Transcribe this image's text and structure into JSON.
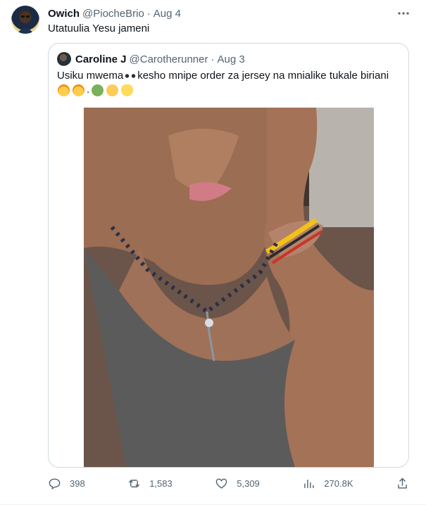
{
  "tweet": {
    "author_name": "Owich",
    "author_handle": "@PiocheBrio",
    "separator": "·",
    "time": "Aug 4",
    "text": "Utatuulia Yesu jameni",
    "more_icon": "more-horizontal-icon"
  },
  "quoted": {
    "author_name": "Caroline J",
    "author_handle": "@Carotherunner",
    "separator": "·",
    "time": "Aug 3",
    "text_before_emoji": "Usiku mwema",
    "text_after_emoji": "kesho mnipe order za jersey na mnialike tukale biriani",
    "emoji_tail_separator": ".",
    "emojis_line1": [
      "eyes"
    ],
    "emojis_line2": [
      "partying-face",
      "partying-face"
    ],
    "emojis_line3": [
      "green-heart",
      "yellow-heart",
      "handshake"
    ]
  },
  "actions": {
    "replies": "398",
    "retweets": "1,583",
    "likes": "5,309",
    "views": "270.8K"
  },
  "colors": {
    "text_primary": "#0f1419",
    "text_secondary": "#536471",
    "border": "#cfd9de"
  }
}
